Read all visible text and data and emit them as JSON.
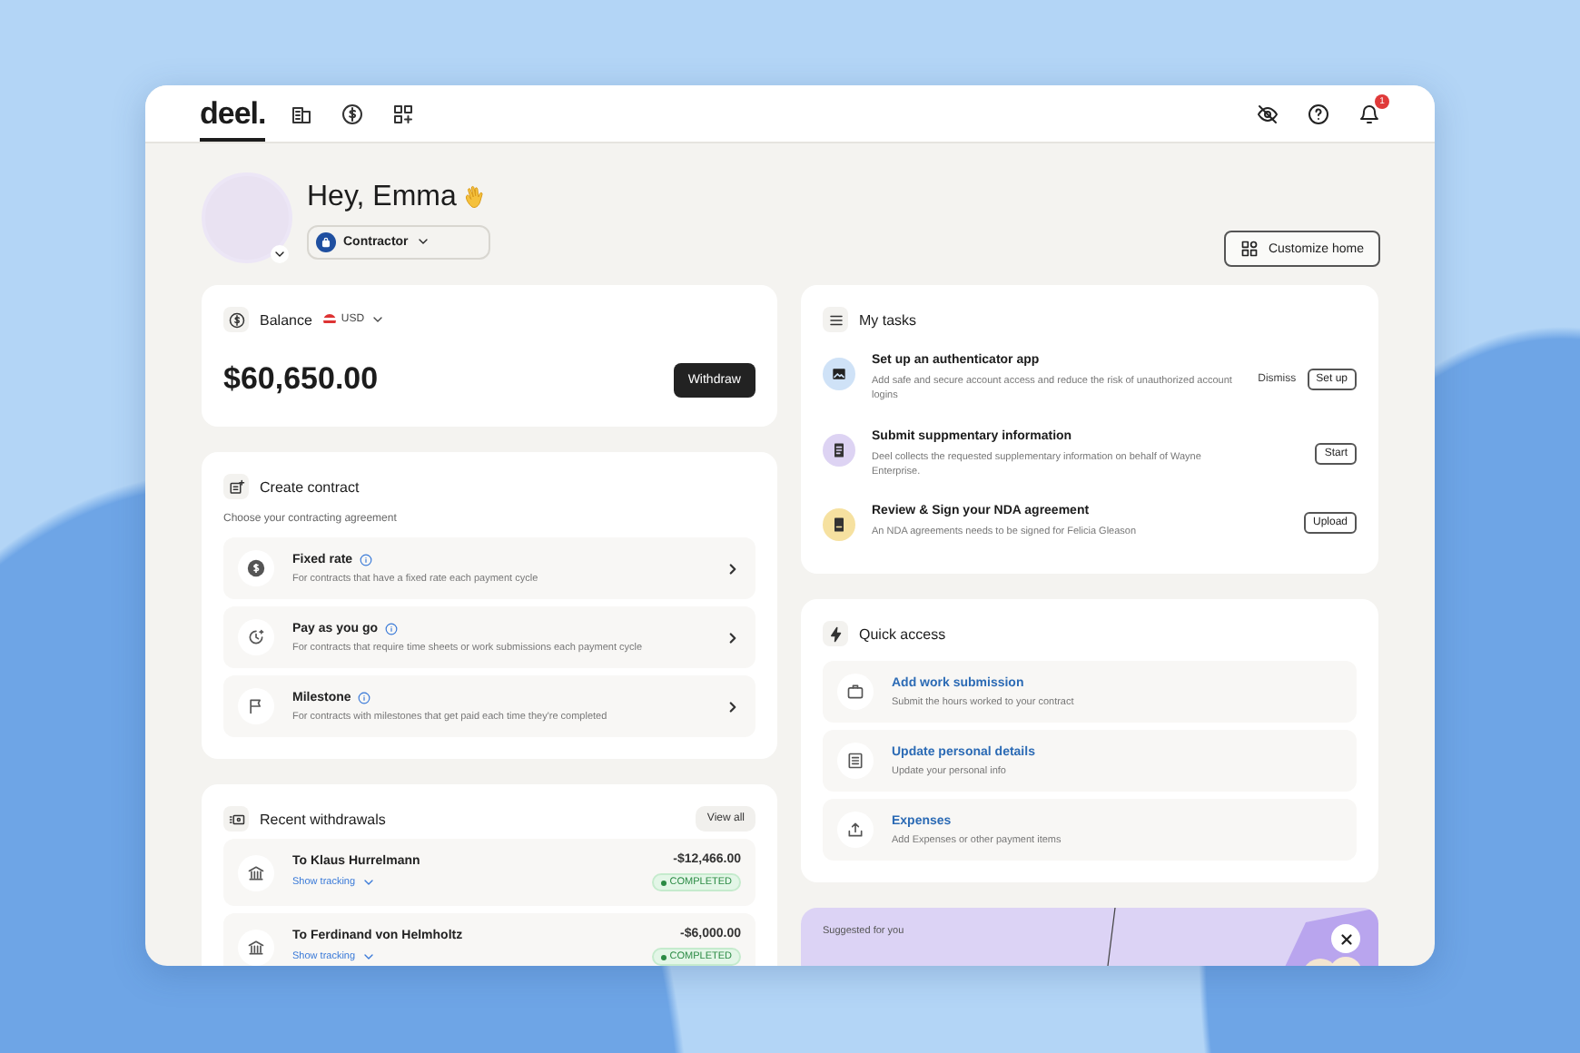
{
  "header": {
    "logo": {
      "text": "deel.",
      "selected": true
    },
    "notification_count": "1"
  },
  "greeting": {
    "text": "Hey, Emma",
    "role": "Contractor"
  },
  "customize_button": "Customize home",
  "balance": {
    "title": "Balance",
    "currency": "USD",
    "amount": "$60,650.00",
    "button": "Withdraw"
  },
  "create_contract": {
    "title": "Create contract",
    "subtitle": "Choose your contracting agreement",
    "options": [
      {
        "kind": "fixed",
        "title": "Fixed rate",
        "description": "For contracts that have a fixed rate each payment cycle"
      },
      {
        "kind": "payg",
        "title": "Pay as you go",
        "description": "For contracts that require time sheets or work submissions each payment cycle"
      },
      {
        "kind": "milestone",
        "title": "Milestone",
        "description": "For contracts with milestones that get paid each time they're completed"
      }
    ]
  },
  "withdrawals": {
    "title": "Recent withdrawals",
    "view_all": "View all",
    "rows": [
      {
        "recipient": "To Klaus Hurrelmann",
        "tracking": "Show tracking",
        "amount": "-$12,466.00",
        "status": "COMPLETED"
      },
      {
        "recipient": "To Ferdinand von Helmholtz",
        "tracking": "Show tracking",
        "amount": "-$6,000.00",
        "status": "COMPLETED"
      }
    ]
  },
  "tasks": {
    "title": "My tasks",
    "items": [
      {
        "kind": "auth",
        "title": "Set up an authenticator app",
        "description": "Add safe and secure account access and reduce the risk of unauthorized account logins",
        "actions": [
          {
            "kind": "link",
            "label": "Dismiss"
          },
          {
            "kind": "button",
            "label": "Set up"
          }
        ]
      },
      {
        "kind": "info",
        "title": "Submit suppmentary information",
        "description": "Deel collects the requested supplementary information on behalf of Wayne Enterprise.",
        "actions": [
          {
            "kind": "button",
            "label": "Start"
          }
        ]
      },
      {
        "kind": "sign",
        "title": "Review & Sign your NDA agreement",
        "description": "An NDA agreements needs to be signed for Felicia Gleason",
        "actions": [
          {
            "kind": "button",
            "label": "Upload"
          }
        ]
      }
    ]
  },
  "quick_access": {
    "title": "Quick access",
    "items": [
      {
        "kind": "work",
        "title": "Add work submission",
        "description": "Submit the hours worked to your contract"
      },
      {
        "kind": "details",
        "title": "Update personal details",
        "description": "Update your personal info"
      },
      {
        "kind": "expenses",
        "title": "Expenses",
        "description": "Add Expenses or other payment items"
      }
    ]
  },
  "suggestion": {
    "label": "Suggested for you"
  }
}
